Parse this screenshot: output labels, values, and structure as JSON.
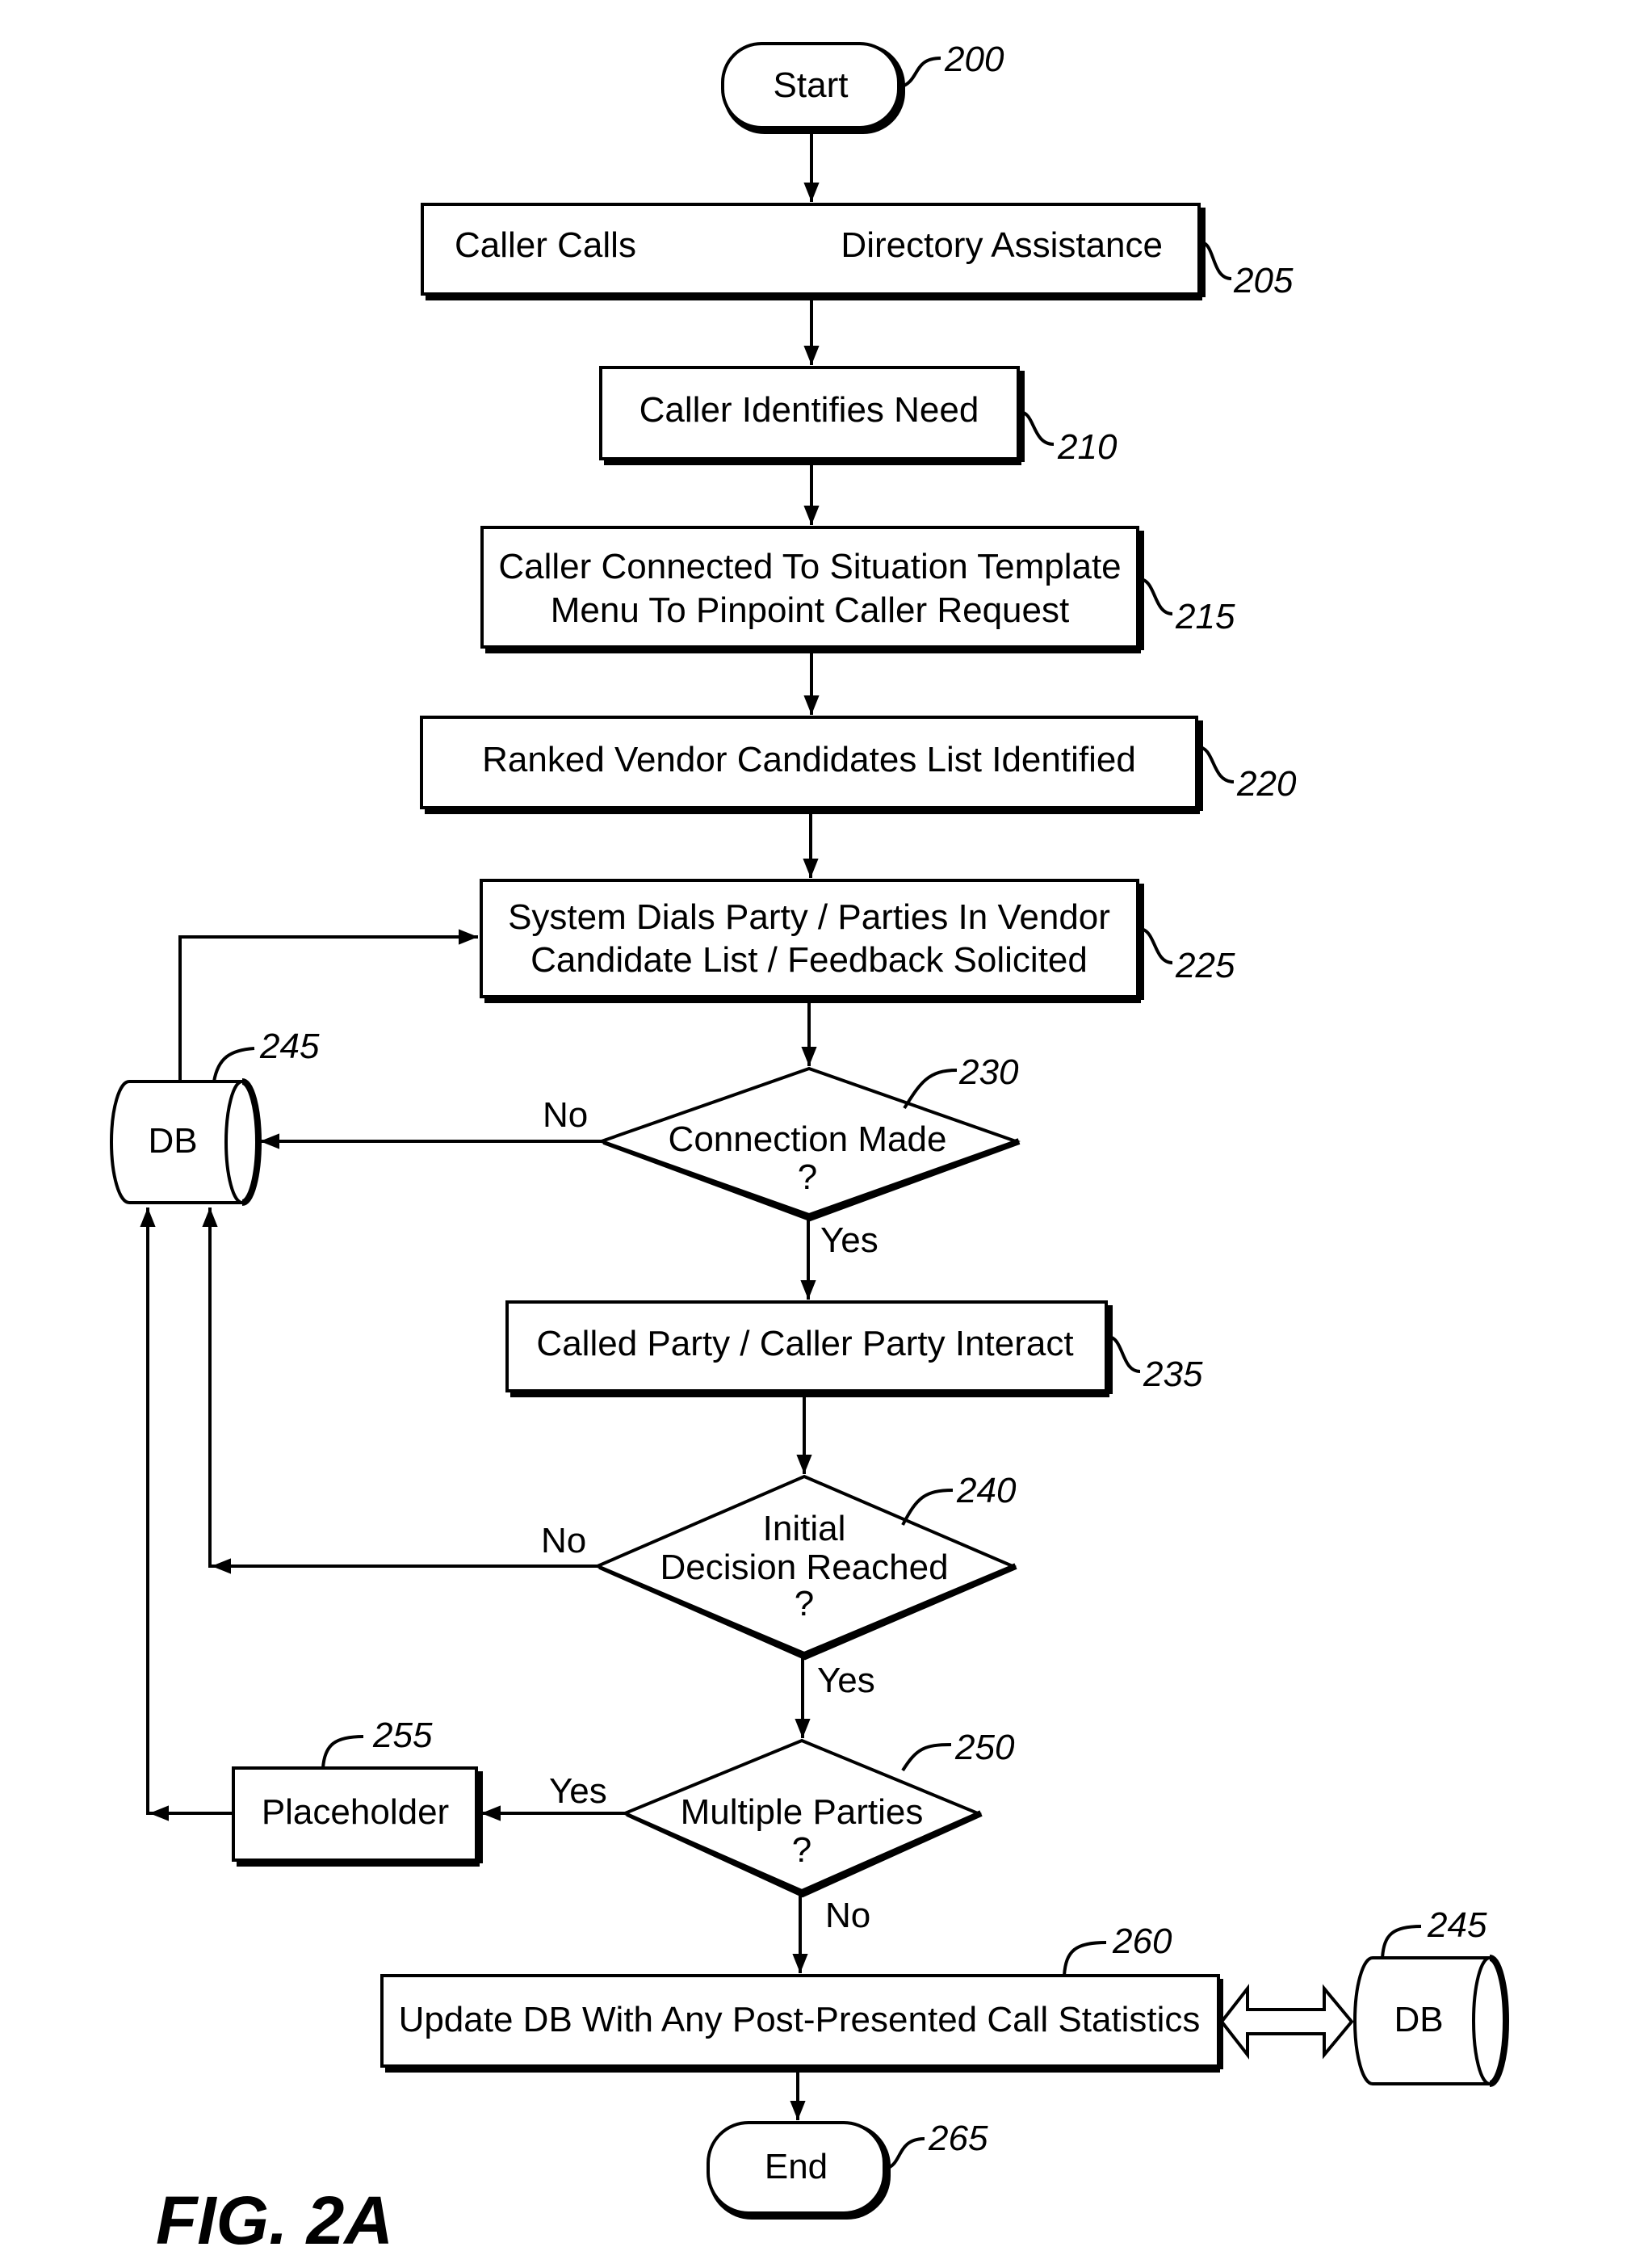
{
  "figure_label": "FIG. 2A",
  "nodes": {
    "start": {
      "label": "Start",
      "ref": "200"
    },
    "n205": {
      "label_left": "Caller Calls",
      "label_right": "Directory Assistance",
      "ref": "205"
    },
    "n210": {
      "label": "Caller Identifies Need",
      "ref": "210"
    },
    "n215": {
      "line1": "Caller Connected To Situation Template",
      "line2": "Menu To Pinpoint Caller Request",
      "ref": "215"
    },
    "n220": {
      "label": "Ranked Vendor Candidates List Identified",
      "ref": "220"
    },
    "n225": {
      "line1": "System Dials Party / Parties In Vendor",
      "line2": "Candidate List / Feedback Solicited",
      "ref": "225"
    },
    "n230": {
      "line1": "Connection Made",
      "line2": "?",
      "ref": "230"
    },
    "db_left": {
      "label": "DB",
      "ref": "245"
    },
    "n235": {
      "label": "Called Party / Caller Party Interact",
      "ref": "235"
    },
    "n240": {
      "line1": "Initial",
      "line2": "Decision Reached",
      "line3": "?",
      "ref": "240"
    },
    "n250": {
      "line1": "Multiple Parties",
      "line2": "?",
      "ref": "250"
    },
    "n255": {
      "label": "Placeholder",
      "ref": "255"
    },
    "n260": {
      "label": "Update DB With Any Post-Presented Call Statistics",
      "ref": "260"
    },
    "db_right": {
      "label": "DB",
      "ref": "245"
    },
    "end": {
      "label": "End",
      "ref": "265"
    }
  },
  "edge_labels": {
    "n230_no": "No",
    "n230_yes": "Yes",
    "n240_no": "No",
    "n240_yes": "Yes",
    "n250_yes": "Yes",
    "n250_no": "No"
  }
}
